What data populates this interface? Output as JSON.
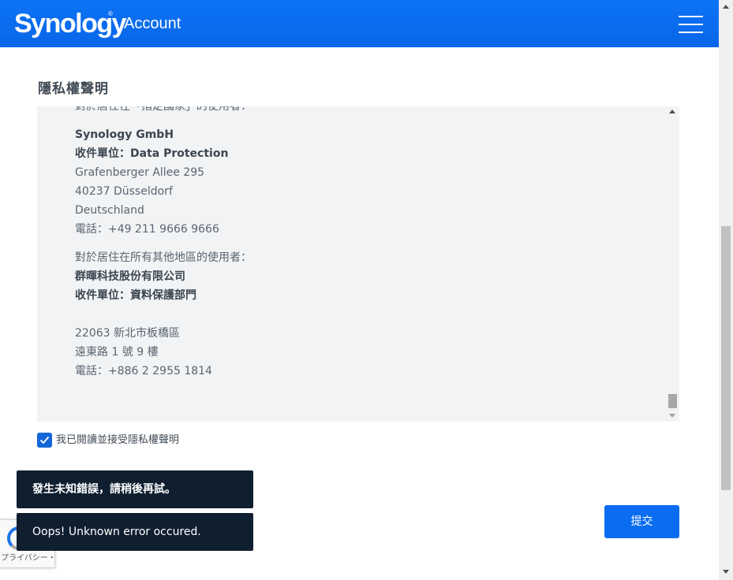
{
  "header": {
    "logo": "Synology",
    "logo_mark": "®",
    "title": "Account",
    "menu_icon": "hamburger-menu-icon"
  },
  "section": {
    "title": "隱私權聲明"
  },
  "policy": {
    "lines": [
      "對於居住在「指定國家」的使用者：",
      "Synology GmbH",
      "Grafenberger Allee 295",
      "40237 Düsseldorf",
      "Deutschland",
      "電話：+49 211 9666 9666",
      "對於居住在所有其他地區的使用者：",
      "群暉科技股份有限公司",
      "收件單位：資料保護部門",
      "22063 新北市板橋區",
      "遠東路 1 號 9 樓",
      "電話：+886 2 2955 1814"
    ],
    "recipient_prefix": "收件單位：",
    "recipient_value": "Data Protection"
  },
  "agree": {
    "checked": true,
    "label": "我已閱讀並接受隱私權聲明"
  },
  "toasts": [
    "發生未知錯誤，請稍後再試。",
    "Oops! Unknown error occured."
  ],
  "submit_label": "提交",
  "recaptcha": {
    "text": "プライバシー・利用規約"
  },
  "colors": {
    "brand_blue": "#0a6cf0",
    "toast_bg": "#0f1f30",
    "panel_bg": "#f1f3f5"
  }
}
